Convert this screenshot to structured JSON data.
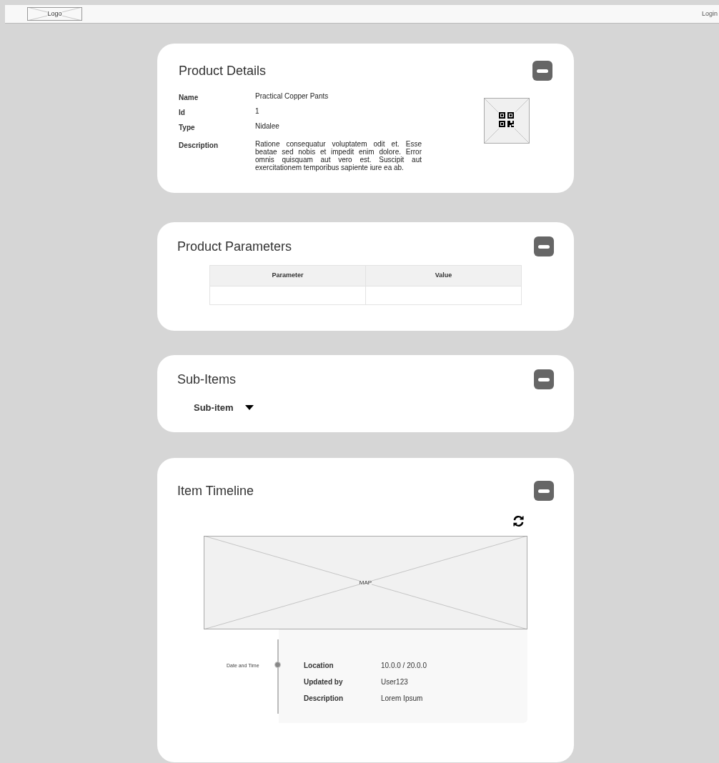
{
  "header": {
    "logo": "Logo",
    "login": "Login"
  },
  "sections": [
    {
      "kind": "details",
      "title": "Product Details",
      "fields": [
        {
          "label": "Name",
          "value": "Practical Copper Pants"
        },
        {
          "label": "Id",
          "value": "1"
        },
        {
          "label": "Type",
          "value": "Nidalee"
        },
        {
          "label": "Description",
          "value": "Ratione consequatur voluptatem odit et. Esse beatae sed nobis et impedit enim dolore. Error omnis quisquam aut vero est. Suscipit aut exercitationem temporibus sapiente iure ea ab."
        }
      ]
    },
    {
      "kind": "parameters",
      "title": "Product Parameters",
      "columns": [
        "Parameter",
        "Value"
      ]
    },
    {
      "kind": "subitems",
      "title": "Sub-Items",
      "items": [
        "Sub-item"
      ]
    },
    {
      "kind": "timeline",
      "title": "Item Timeline",
      "map_label": "MAP",
      "entry": {
        "time": "Date and Time",
        "fields": [
          {
            "label": "Location",
            "value": "10.0.0 / 20.0.0"
          },
          {
            "label": "Updated by",
            "value": "User123"
          },
          {
            "label": "Description",
            "value": "Lorem Ipsum"
          }
        ]
      }
    }
  ]
}
